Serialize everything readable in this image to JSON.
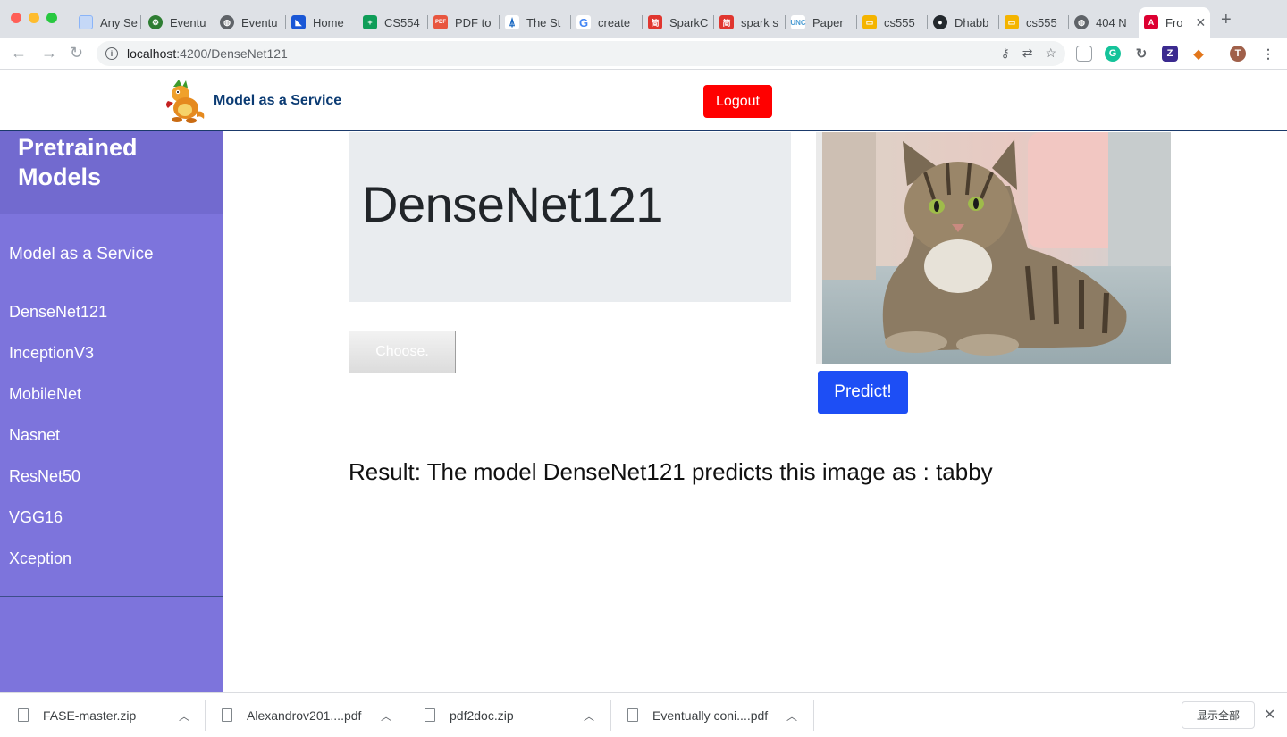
{
  "browser": {
    "tabs": [
      {
        "title": "Any Se",
        "icon": "doc-icon",
        "color": "#8ab4f8"
      },
      {
        "title": "Eventu",
        "icon": "gear-icon",
        "color": "#2e7d32"
      },
      {
        "title": "Eventu",
        "icon": "globe-icon",
        "color": "#5f6368"
      },
      {
        "title": "Home",
        "icon": "home-icon",
        "color": "#1a57d6"
      },
      {
        "title": "CS554",
        "icon": "sheets-icon",
        "color": "#0f9d58"
      },
      {
        "title": "PDF to",
        "icon": "pdf-icon",
        "color": "#e8563f"
      },
      {
        "title": "The St",
        "icon": "book-icon",
        "color": "#1565c0"
      },
      {
        "title": "create",
        "icon": "google-icon",
        "color": "#4285f4"
      },
      {
        "title": "SparkC",
        "icon": "jian-icon",
        "color": "#e0362f"
      },
      {
        "title": "spark s",
        "icon": "jian-icon",
        "color": "#e0362f"
      },
      {
        "title": "Paper",
        "icon": "unc-icon",
        "color": "#4b9cd3"
      },
      {
        "title": "cs555",
        "icon": "slides-icon",
        "color": "#f4b400"
      },
      {
        "title": "Dhabb",
        "icon": "github-icon",
        "color": "#24292e"
      },
      {
        "title": "cs555",
        "icon": "slides-icon",
        "color": "#f4b400"
      },
      {
        "title": "404 N",
        "icon": "globe-icon",
        "color": "#5f6368"
      },
      {
        "title": "Fro",
        "icon": "angular-icon",
        "color": "#dd0031"
      }
    ],
    "url_host": "localhost",
    "url_path": ":4200/DenseNet121",
    "profile_initial": "T"
  },
  "header": {
    "brand": "Model as a Service",
    "logout_label": "Logout"
  },
  "sidebar": {
    "title": "Pretrained Models",
    "subtitle": "Model as a Service",
    "items": [
      {
        "label": "DenseNet121"
      },
      {
        "label": "InceptionV3"
      },
      {
        "label": "MobileNet"
      },
      {
        "label": "Nasnet"
      },
      {
        "label": "ResNet50"
      },
      {
        "label": "VGG16"
      },
      {
        "label": "Xception"
      }
    ]
  },
  "main": {
    "model_name": "DenseNet121",
    "choose_label": "Choose.",
    "predict_label": "Predict!",
    "result_text": "Result: The model DenseNet121 predicts this image as : tabby"
  },
  "downloads": {
    "items": [
      {
        "name": "FASE-master.zip"
      },
      {
        "name": "Alexandrov201....pdf"
      },
      {
        "name": "pdf2doc.zip"
      },
      {
        "name": "Eventually coni....pdf"
      }
    ],
    "show_all_label": "显示全部"
  },
  "colors": {
    "sidebar_bg": "#7d74dc",
    "logout_bg": "#ff0000",
    "predict_bg": "#1d4ef5",
    "brand_text": "#0b3b73"
  }
}
